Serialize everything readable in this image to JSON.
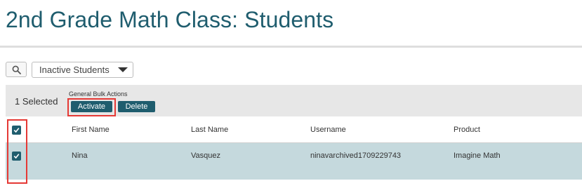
{
  "page": {
    "title": "2nd Grade Math Class: Students"
  },
  "toolbar": {
    "search_icon": "search-icon",
    "filter": {
      "selected": "Inactive Students"
    }
  },
  "bulk": {
    "selected_text": "1 Selected",
    "label": "General Bulk Actions",
    "activate_label": "Activate",
    "delete_label": "Delete"
  },
  "table": {
    "columns": [
      "First Name",
      "Last Name",
      "Username",
      "Product"
    ],
    "rows": [
      {
        "checked": true,
        "first_name": "Nina",
        "last_name": "Vasquez",
        "username": "ninavarchived1709229743",
        "product": "Imagine Math"
      }
    ]
  },
  "colors": {
    "accent": "#1f5d6e",
    "row_highlight": "#c5d9dd",
    "annotation": "#e53935"
  }
}
